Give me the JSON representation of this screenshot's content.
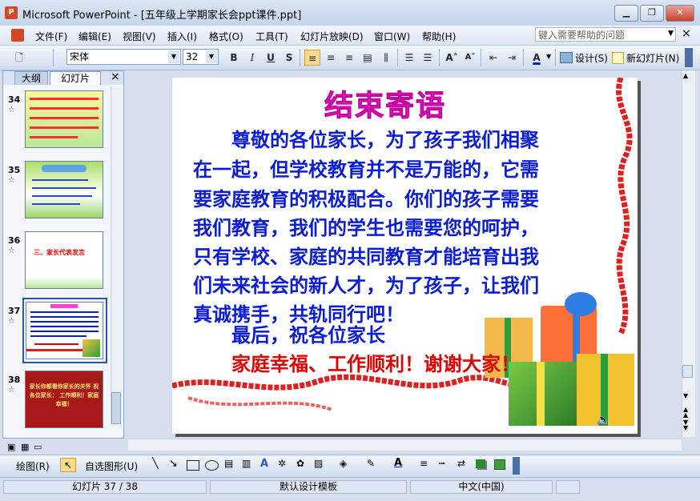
{
  "window": {
    "title": "Microsoft PowerPoint - [五年级上学期家长会ppt课件.ppt]",
    "app_icon": "P",
    "minimize": "▁",
    "restore": "❐",
    "close": "✕"
  },
  "menu": {
    "items": [
      "文件(F)",
      "编辑(E)",
      "视图(V)",
      "插入(I)",
      "格式(O)",
      "工具(T)",
      "幻灯片放映(D)",
      "窗口(W)",
      "帮助(H)"
    ],
    "help_placeholder": "键入需要帮助的问题",
    "doc_close": "×"
  },
  "toolbar": {
    "font_name": "宋体",
    "font_size": "32",
    "bold": "B",
    "italic": "I",
    "underline": "U",
    "shadow": "S",
    "design_label": "设计(S)",
    "new_slide_label": "新幻灯片(N)"
  },
  "panel": {
    "tab_outline": "大纲",
    "tab_slides": "幻灯片",
    "close": "×",
    "slides": [
      {
        "num": "34",
        "star": "☆"
      },
      {
        "num": "35",
        "star": "☆"
      },
      {
        "num": "36",
        "star": "☆",
        "text": "三、家长代表发言"
      },
      {
        "num": "37",
        "star": "☆"
      },
      {
        "num": "38",
        "star": "☆",
        "text": "家长你都看你家长的关怀 祝各位家长： 工作顺利！家庭幸福！"
      }
    ]
  },
  "slide": {
    "title": "结束寄语",
    "lines": [
      "　　尊敬的各位家长，为了孩子我们相聚",
      "在一起，但学校教育并不是万能的，它需",
      "要家庭教育的积极配合。你们的孩子需要",
      "我们教育，我们的学生也需要您的呵护，",
      "只有学校、家庭的共同教育才能培育出我",
      "们未来社会的新人才，为了孩子，让我们",
      "真诚携手，共轨同行吧！",
      "　　最后，祝各位家长"
    ],
    "closing_line": "　　家庭幸福、工作顺利！谢谢大家！"
  },
  "drawbar": {
    "draw_label": "绘图(R)",
    "autoshape_label": "自选图形(U)"
  },
  "status": {
    "slide_indicator": "幻灯片 37 / 38",
    "template": "默认设计模板",
    "language": "中文(中国)"
  },
  "colors": {
    "title_pink": "#ff3fd6",
    "body_blue": "#0a1cd6",
    "closing_red": "#e00000"
  }
}
